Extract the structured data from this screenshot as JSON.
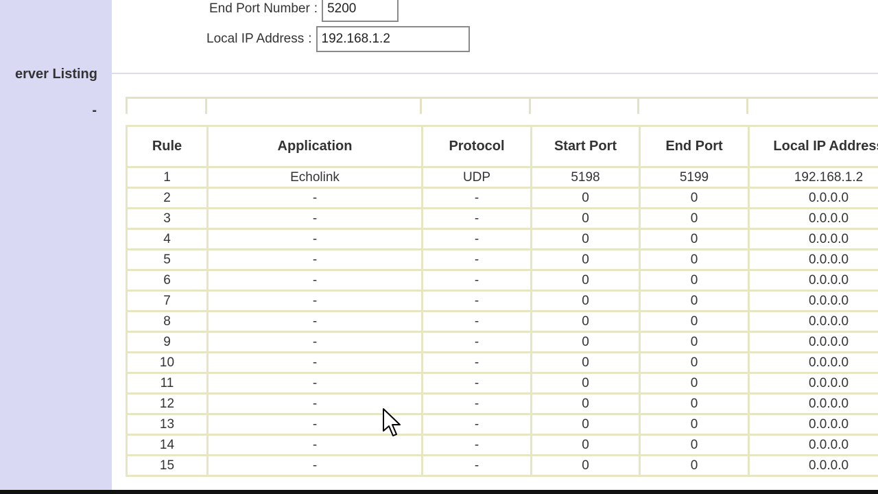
{
  "sidebar": {
    "label": "erver Listing",
    "dash": "-"
  },
  "form": {
    "end_port": {
      "label": "End Port Number",
      "value": "5200"
    },
    "local_ip": {
      "label": "Local IP Address",
      "value": "192.168.1.2"
    },
    "colon": ":"
  },
  "table": {
    "headers": [
      "Rule",
      "Application",
      "Protocol",
      "Start Port",
      "End Port",
      "Local IP Address"
    ],
    "rows": [
      [
        "1",
        "Echolink",
        "UDP",
        "5198",
        "5199",
        "192.168.1.2"
      ],
      [
        "2",
        "-",
        "-",
        "0",
        "0",
        "0.0.0.0"
      ],
      [
        "3",
        "-",
        "-",
        "0",
        "0",
        "0.0.0.0"
      ],
      [
        "4",
        "-",
        "-",
        "0",
        "0",
        "0.0.0.0"
      ],
      [
        "5",
        "-",
        "-",
        "0",
        "0",
        "0.0.0.0"
      ],
      [
        "6",
        "-",
        "-",
        "0",
        "0",
        "0.0.0.0"
      ],
      [
        "7",
        "-",
        "-",
        "0",
        "0",
        "0.0.0.0"
      ],
      [
        "8",
        "-",
        "-",
        "0",
        "0",
        "0.0.0.0"
      ],
      [
        "9",
        "-",
        "-",
        "0",
        "0",
        "0.0.0.0"
      ],
      [
        "10",
        "-",
        "-",
        "0",
        "0",
        "0.0.0.0"
      ],
      [
        "11",
        "-",
        "-",
        "0",
        "0",
        "0.0.0.0"
      ],
      [
        "12",
        "-",
        "-",
        "0",
        "0",
        "0.0.0.0"
      ],
      [
        "13",
        "-",
        "-",
        "0",
        "0",
        "0.0.0.0"
      ],
      [
        "14",
        "-",
        "-",
        "0",
        "0",
        "0.0.0.0"
      ],
      [
        "15",
        "-",
        "-",
        "0",
        "0",
        "0.0.0.0"
      ]
    ]
  },
  "icons": {
    "cursor": "mouse-pointer-icon"
  }
}
